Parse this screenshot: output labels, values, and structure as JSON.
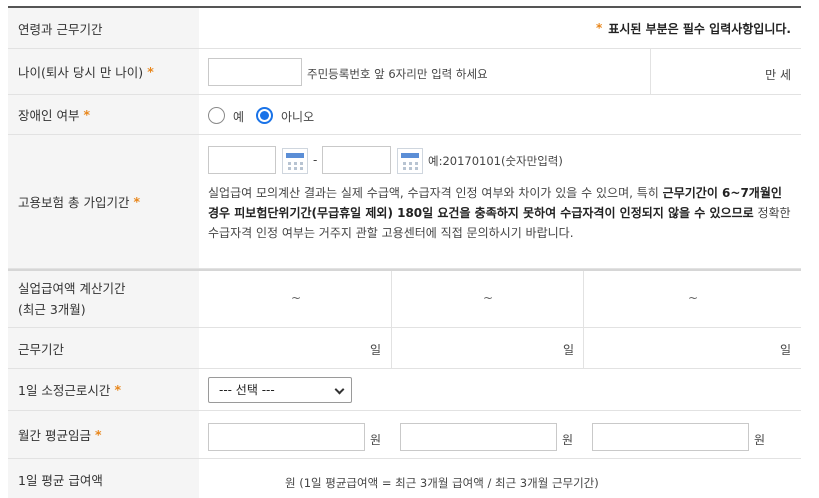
{
  "header": {
    "title": "연령과 근무기간",
    "required_star": "*",
    "required_note": "표시된 부분은 필수 입력사항입니다."
  },
  "age": {
    "label": "나이(퇴사 당시 만 나이)",
    "star": "*",
    "input_value": "",
    "hint": "주민등록번호 앞 6자리만 입력 하세요",
    "unit": "만 세"
  },
  "disability": {
    "label": "장애인 여부",
    "star": "*",
    "options": [
      {
        "label": "예",
        "selected": false
      },
      {
        "label": "아니오",
        "selected": true
      }
    ]
  },
  "insurance_period": {
    "label": "고용보험 총 가입기간",
    "star": "*",
    "start_value": "",
    "separator": "-",
    "end_value": "",
    "example": "예:20170101(숫자만입력)",
    "notice": {
      "part1": "실업급여 모의계산 결과는 실제 수급액, 수급자격 인정 여부와 차이가 있을 수 있으며, 특히 ",
      "bold1": "근무기간이 6~7개월인 경우 피보험단위기간(무급휴일 제외) 180일 요건을 충족하지 못하여 수급자격이 인정되지 않을 수 있으므로",
      "part2": " 정확한 수급자격 인정 여부는 거주지 관할 고용센터에 직접 문의하시기 바랍니다."
    }
  },
  "calc_period": {
    "label_line1": "실업급여액 계산기간",
    "label_line2": "(최근 3개월)",
    "periods": [
      "~",
      "~",
      "~"
    ]
  },
  "work_days": {
    "label": "근무기간",
    "unit": "일",
    "values": [
      "",
      "",
      ""
    ]
  },
  "daily_hours": {
    "label": "1일 소정근로시간",
    "star": "*",
    "selected": "--- 선택 ---"
  },
  "monthly_wage": {
    "label": "월간 평균임금",
    "star": "*",
    "unit": "원",
    "values": [
      "",
      "",
      ""
    ]
  },
  "daily_benefit": {
    "label": "1일 평균 급여액",
    "formula": "원 (1일 평균급여액 = 최근 3개월 급여액 / 최근 3개월 근무기간)"
  },
  "colors": {
    "accent": "#e8861b",
    "radio_on": "#1a73e8",
    "label_bg": "#f5f5f5"
  }
}
